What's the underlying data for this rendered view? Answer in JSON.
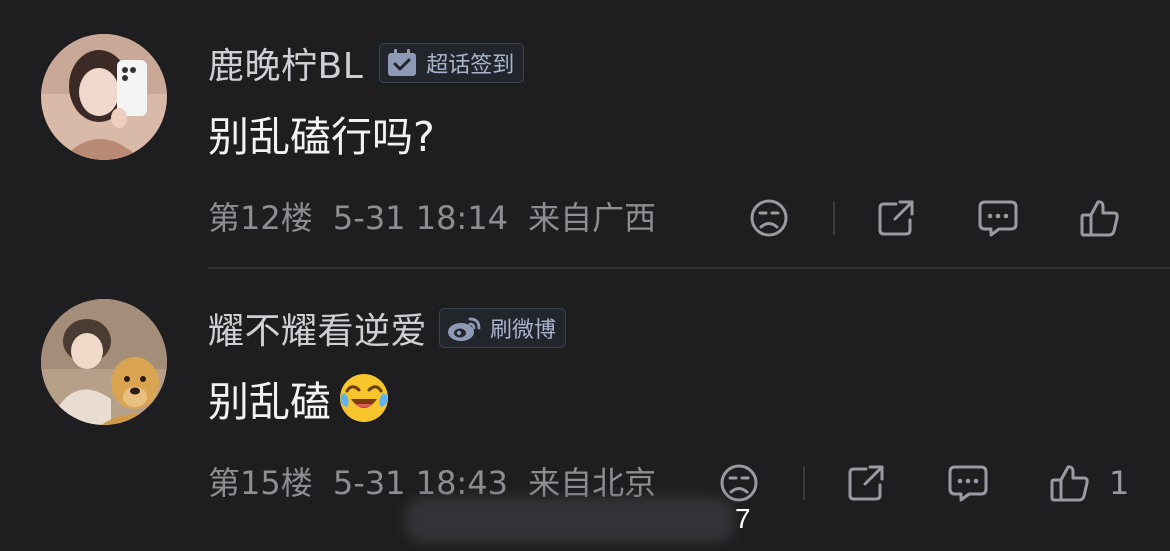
{
  "comments": [
    {
      "username": "鹿晚柠BL",
      "badge_label": "超话签到",
      "badge_icon": "checkin-calendar-icon",
      "content": "别乱磕行吗?",
      "floor": "第12楼",
      "time": "5-31 18:14",
      "location": "来自广西",
      "like_count": ""
    },
    {
      "username": "耀不耀看逆爱",
      "badge_label": "刷微博",
      "badge_icon": "weibo-icon",
      "content": "别乱磕",
      "content_emoji": "laughing-crying-emoji",
      "floor": "第15楼",
      "time": "5-31 18:43",
      "location": "来自北京",
      "like_count": "1"
    }
  ],
  "overlay_number": "7",
  "colors": {
    "background": "#1e1e20",
    "username": "#cfcfd3",
    "content": "#f2f2f4",
    "meta": "#8d8d92",
    "badge_text": "#a9b4cc"
  }
}
